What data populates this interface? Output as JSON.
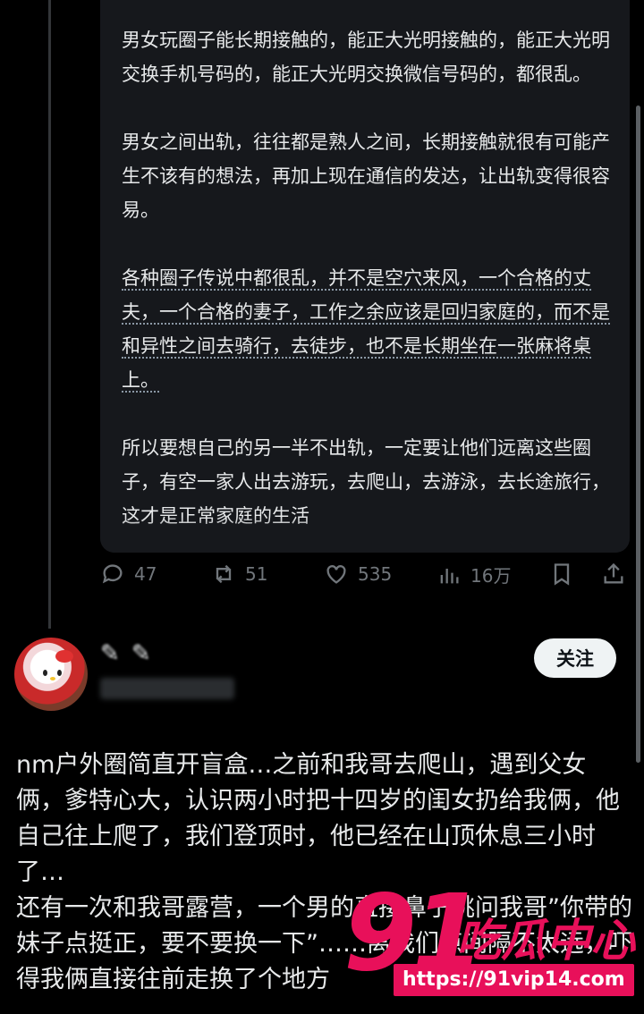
{
  "quoted_post": {
    "paragraphs": [
      "男女玩圈子能长期接触的，能正大光明接触的，能正大光明交换手机号码的，能正大光明交换微信号码的，都很乱。",
      "男女之间出轨，往往都是熟人之间，长期接触就很有可能产生不该有的想法，再加上现在通信的发达，让出轨变得很容易。",
      "各种圈子传说中都很乱，并不是空穴来风，一个合格的丈夫，一个合格的妻子，工作之余应该是回归家庭的，而不是和异性之间去骑行，去徒步，也不是长期坐在一张麻将桌上。",
      "所以要想自己的另一半不出轨，一定要让他们远离这些圈子，有空一家人出去游玩，去爬山，去游泳，去长途旅行，这才是正常家庭的生活"
    ]
  },
  "actions": {
    "replies": "47",
    "reposts": "51",
    "likes": "535",
    "views": "16万"
  },
  "reply": {
    "follow_label": "关注",
    "paragraphs": [
      "nm户外圈简直开盲盒…之前和我哥去爬山，遇到父女俩，爹特心大，认识两小时把十四岁的闺女扔给我俩，他自己往上爬了，我们登顶时，他已经在山顶休息三小时了…",
      "还有一次和我哥露营，一个男的直接鼻子挑问我哥”你带的妹子点挺正，要不要换一下”……离我们点间隔不太远，吓得我俩直接往前走换了个地方"
    ]
  },
  "watermark": {
    "number": "91",
    "text": "吃瓜中心",
    "url": "https://91vip14.com"
  },
  "icons": [
    "reply-icon",
    "repost-icon",
    "like-icon",
    "views-icon",
    "bookmark-icon",
    "share-icon"
  ]
}
